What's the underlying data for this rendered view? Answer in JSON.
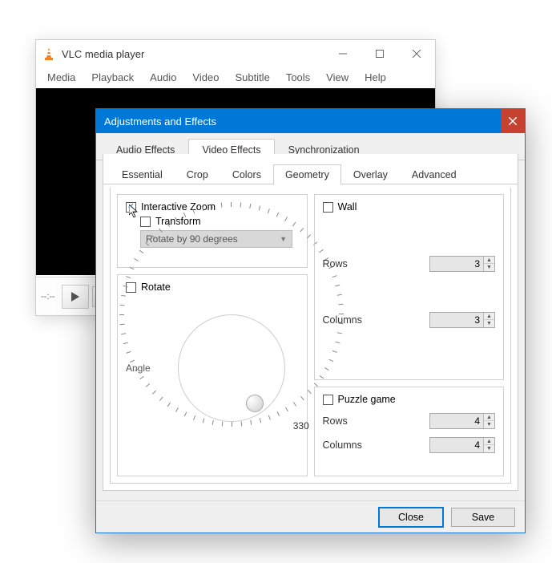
{
  "vlc": {
    "title": "VLC media player",
    "menus": [
      "Media",
      "Playback",
      "Audio",
      "Video",
      "Subtitle",
      "Tools",
      "View",
      "Help"
    ],
    "time": "--:--"
  },
  "dialog": {
    "title": "Adjustments and Effects",
    "tabs_main": [
      "Audio Effects",
      "Video Effects",
      "Synchronization"
    ],
    "active_main": 1,
    "tabs_sub": [
      "Essential",
      "Crop",
      "Colors",
      "Geometry",
      "Overlay",
      "Advanced"
    ],
    "active_sub": 3,
    "geometry": {
      "interactive_zoom": {
        "label": "Interactive Zoom",
        "checked": true
      },
      "transform": {
        "label": "Transform",
        "checked": false,
        "combo": "Rotate by 90 degrees"
      },
      "rotate": {
        "label": "Rotate",
        "checked": false,
        "angle_label": "Angle",
        "angle_value": 330
      },
      "wall": {
        "label": "Wall",
        "checked": false,
        "rows_label": "Rows",
        "rows": 3,
        "cols_label": "Columns",
        "cols": 3
      },
      "puzzle": {
        "label": "Puzzle game",
        "checked": false,
        "rows_label": "Rows",
        "rows": 4,
        "cols_label": "Columns",
        "cols": 4
      }
    },
    "buttons": {
      "close": "Close",
      "save": "Save"
    }
  }
}
